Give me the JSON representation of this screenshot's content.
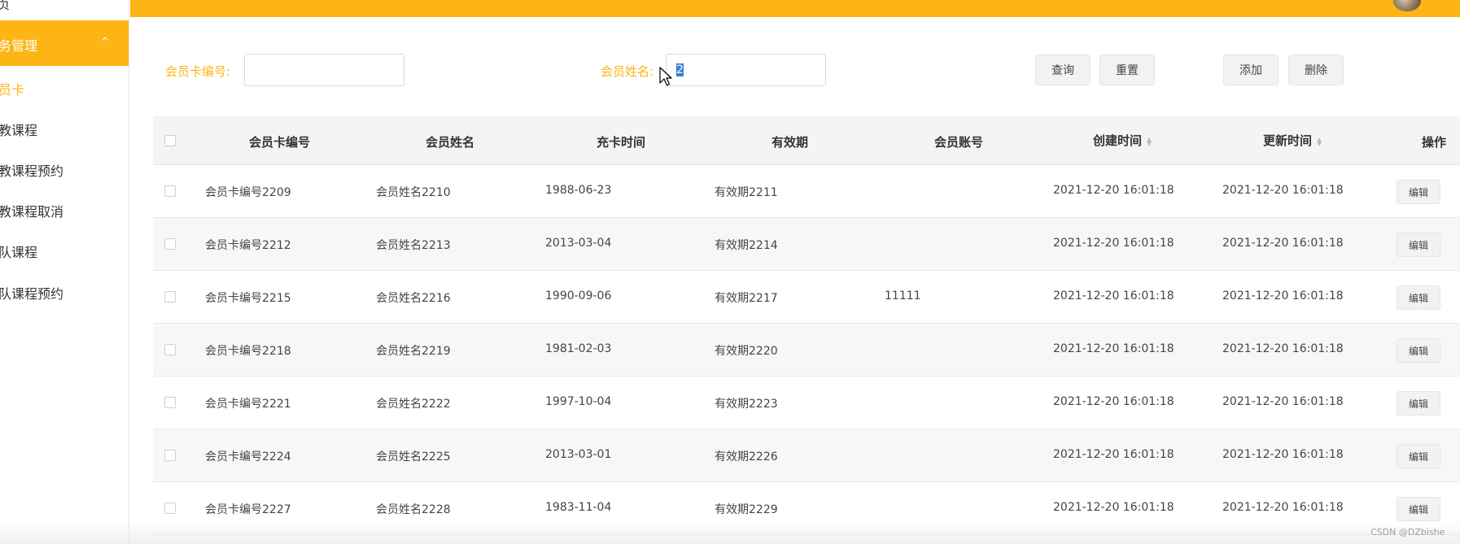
{
  "sidebar": {
    "top_item": "页",
    "active_group": {
      "label": "务管理",
      "chevron": "^"
    },
    "items": [
      {
        "label": "员卡",
        "current": true
      },
      {
        "label": "教课程"
      },
      {
        "label": "教课程预约"
      },
      {
        "label": "教课程取消"
      },
      {
        "label": "队课程"
      },
      {
        "label": "队课程预约"
      }
    ]
  },
  "search": {
    "card_no_label": "会员卡编号:",
    "card_no_value": "",
    "name_label": "会员姓名:",
    "name_value": "2"
  },
  "toolbar": {
    "query_label": "查询",
    "reset_label": "重置",
    "add_label": "添加",
    "delete_label": "删除"
  },
  "table": {
    "columns": [
      "会员卡编号",
      "会员姓名",
      "充卡时间",
      "有效期",
      "会员账号",
      "创建时间",
      "更新时间",
      "操作"
    ],
    "edit_label": "编辑",
    "rows": [
      {
        "card_no": "会员卡编号2209",
        "name": "会员姓名2210",
        "charge_time": "1988-06-23",
        "validity": "有效期2211",
        "account": "",
        "created": "2021-12-20 16:01:18",
        "updated": "2021-12-20 16:01:18"
      },
      {
        "card_no": "会员卡编号2212",
        "name": "会员姓名2213",
        "charge_time": "2013-03-04",
        "validity": "有效期2214",
        "account": "",
        "created": "2021-12-20 16:01:18",
        "updated": "2021-12-20 16:01:18"
      },
      {
        "card_no": "会员卡编号2215",
        "name": "会员姓名2216",
        "charge_time": "1990-09-06",
        "validity": "有效期2217",
        "account": "11111",
        "created": "2021-12-20 16:01:18",
        "updated": "2021-12-20 16:01:18"
      },
      {
        "card_no": "会员卡编号2218",
        "name": "会员姓名2219",
        "charge_time": "1981-02-03",
        "validity": "有效期2220",
        "account": "",
        "created": "2021-12-20 16:01:18",
        "updated": "2021-12-20 16:01:18"
      },
      {
        "card_no": "会员卡编号2221",
        "name": "会员姓名2222",
        "charge_time": "1997-10-04",
        "validity": "有效期2223",
        "account": "",
        "created": "2021-12-20 16:01:18",
        "updated": "2021-12-20 16:01:18"
      },
      {
        "card_no": "会员卡编号2224",
        "name": "会员姓名2225",
        "charge_time": "2013-03-01",
        "validity": "有效期2226",
        "account": "",
        "created": "2021-12-20 16:01:18",
        "updated": "2021-12-20 16:01:18"
      },
      {
        "card_no": "会员卡编号2227",
        "name": "会员姓名2228",
        "charge_time": "1983-11-04",
        "validity": "有效期2229",
        "account": "",
        "created": "2021-12-20 16:01:18",
        "updated": "2021-12-20 16:01:18"
      }
    ]
  },
  "watermark": "CSDN @DZbishe",
  "colors": {
    "accent": "#fdb515",
    "selection": "#3b7dd8"
  }
}
